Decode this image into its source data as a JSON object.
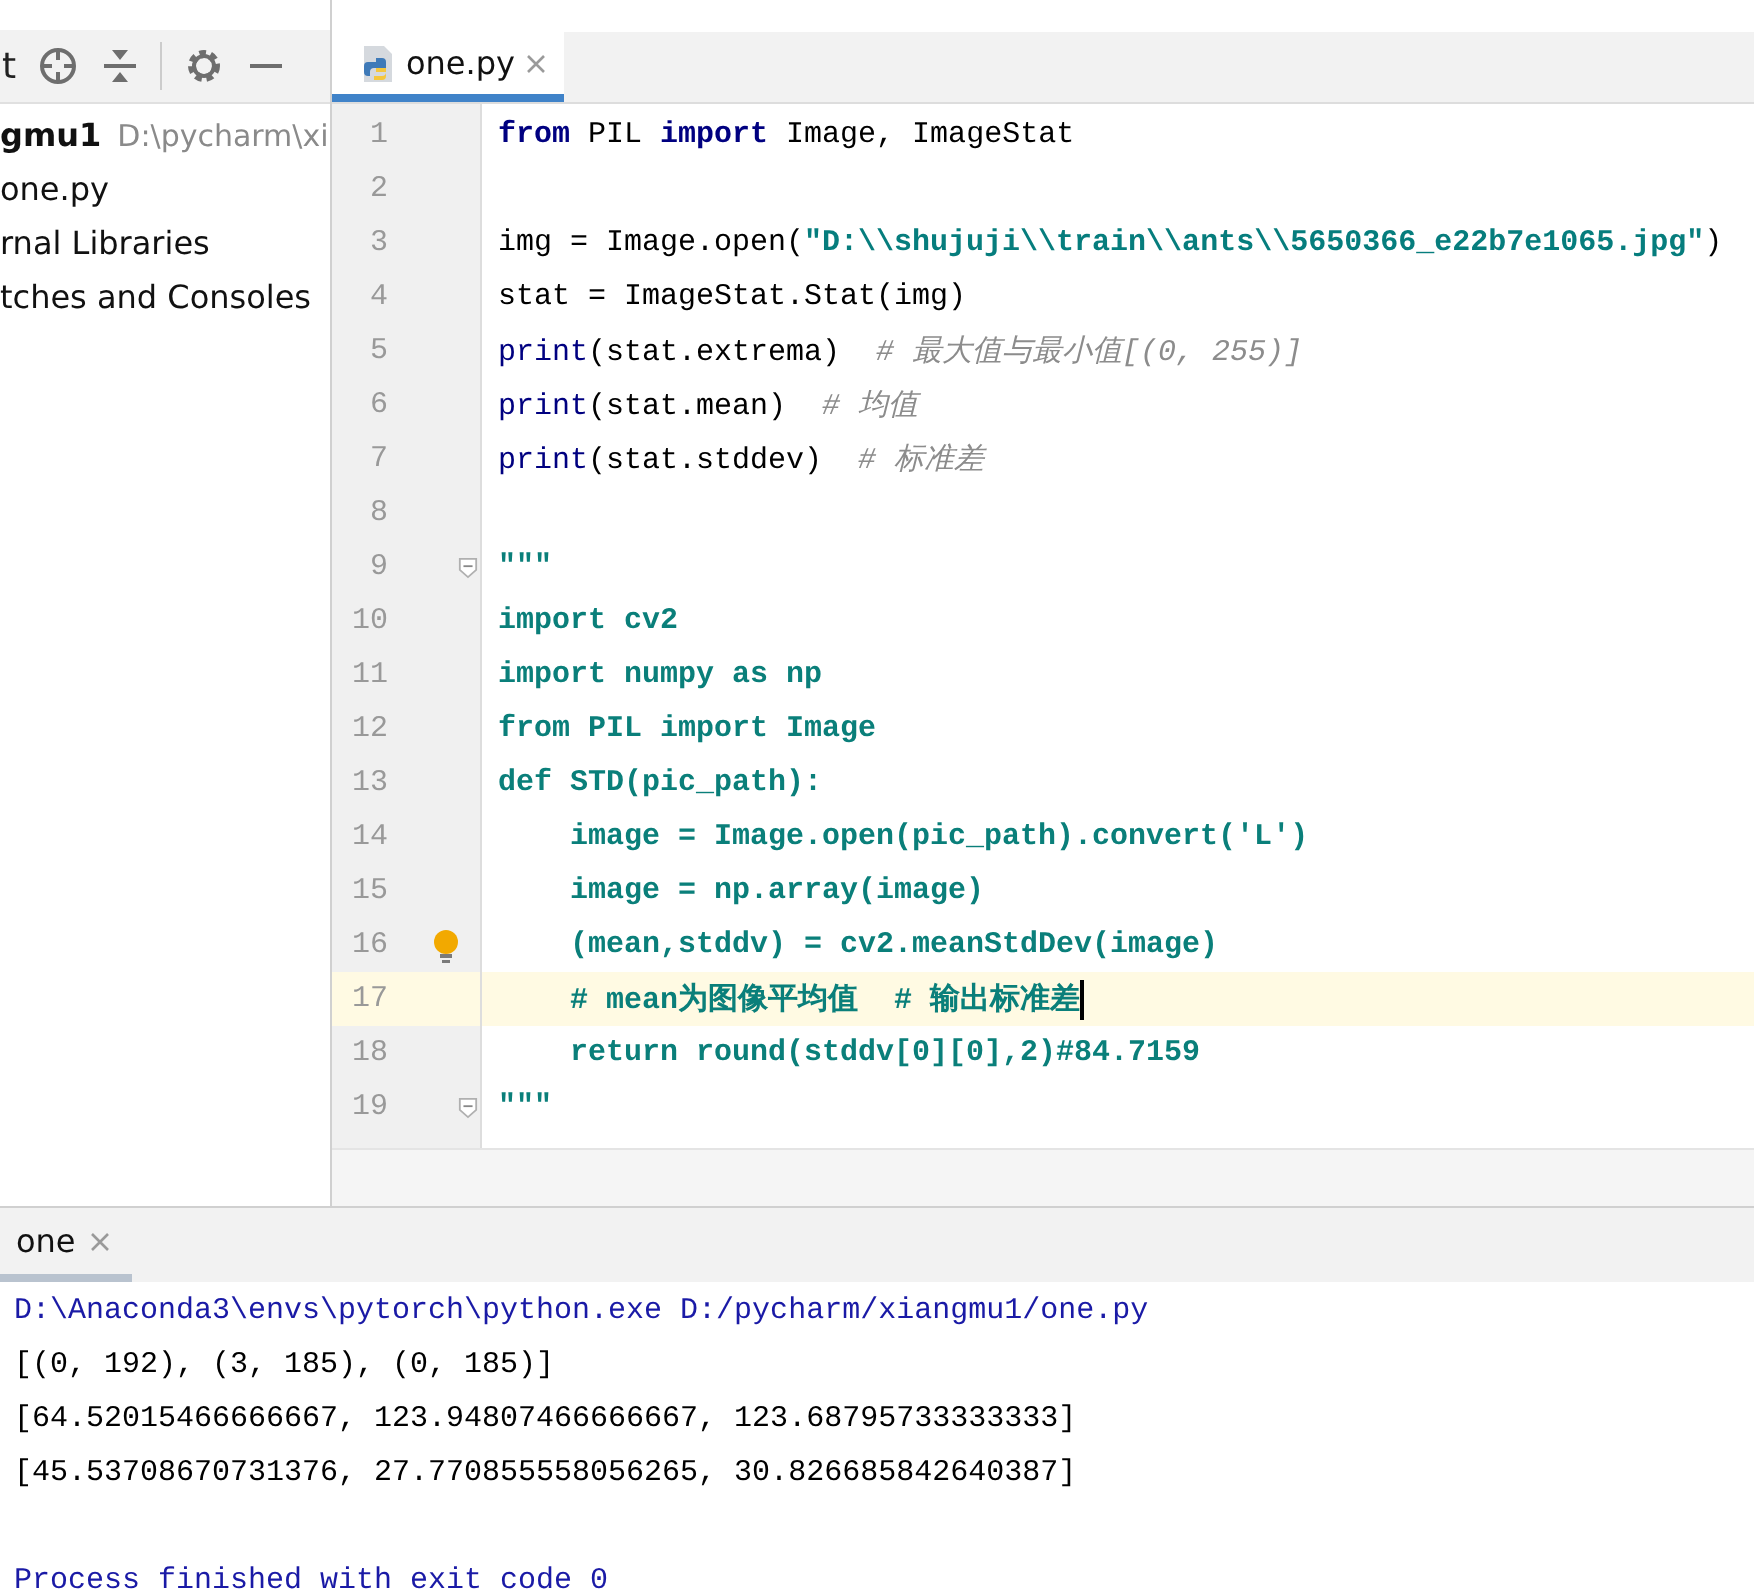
{
  "project_panel": {
    "toolbar_label": "t",
    "tree": [
      {
        "label": "gmu1",
        "path": "D:\\pycharm\\xi",
        "kind": "project"
      },
      {
        "label": "one.py",
        "kind": "file"
      },
      {
        "label": "rnal Libraries",
        "kind": "folder"
      },
      {
        "label": "tches and Consoles",
        "kind": "folder"
      }
    ]
  },
  "editor": {
    "tabs": [
      {
        "label": "one.py",
        "selected": true
      }
    ],
    "lines": [
      {
        "number": "1",
        "segments": [
          {
            "kind": "keyword",
            "text": "from"
          },
          {
            "kind": "plain",
            "text": " PIL "
          },
          {
            "kind": "keyword",
            "text": "import"
          },
          {
            "kind": "plain",
            "text": " Image, ImageStat"
          }
        ]
      },
      {
        "number": "2"
      },
      {
        "number": "3",
        "segments": [
          {
            "kind": "plain",
            "text": "img = Image.open("
          },
          {
            "kind": "string",
            "text": "\"D:\\\\shujuji\\\\train\\\\ants\\\\5650366_e22b7e1065.jpg\""
          },
          {
            "kind": "plain",
            "text": ")"
          }
        ]
      },
      {
        "number": "4",
        "segments": [
          {
            "kind": "plain",
            "text": "stat = ImageStat.Stat(img)"
          }
        ]
      },
      {
        "number": "5",
        "segments": [
          {
            "kind": "builtin",
            "text": "print"
          },
          {
            "kind": "plain",
            "text": "(stat.extrema)  "
          },
          {
            "kind": "comment",
            "text": "# 最大值与最小值[(0, 255)]"
          }
        ]
      },
      {
        "number": "6",
        "segments": [
          {
            "kind": "builtin",
            "text": "print"
          },
          {
            "kind": "plain",
            "text": "(stat.mean)  "
          },
          {
            "kind": "comment",
            "text": "# 均值"
          }
        ]
      },
      {
        "number": "7",
        "segments": [
          {
            "kind": "builtin",
            "text": "print"
          },
          {
            "kind": "plain",
            "text": "(stat.stddev)  "
          },
          {
            "kind": "comment",
            "text": "# 标准差"
          }
        ]
      },
      {
        "number": "8"
      },
      {
        "number": "9",
        "segments": [
          {
            "kind": "docstring",
            "text": "\"\"\""
          }
        ],
        "fold": true
      },
      {
        "number": "10",
        "segments": [
          {
            "kind": "docstring",
            "text": "import cv2"
          }
        ]
      },
      {
        "number": "11",
        "segments": [
          {
            "kind": "docstring",
            "text": "import numpy as np"
          }
        ]
      },
      {
        "number": "12",
        "segments": [
          {
            "kind": "docstring",
            "text": "from PIL import Image"
          }
        ]
      },
      {
        "number": "13",
        "segments": [
          {
            "kind": "docstring",
            "text": "def STD(pic_path):"
          }
        ]
      },
      {
        "number": "14",
        "segments": [
          {
            "kind": "docstring",
            "text": "    image = Image.open(pic_path).convert('L')"
          }
        ]
      },
      {
        "number": "15",
        "segments": [
          {
            "kind": "docstring",
            "text": "    image = np.array(image)"
          }
        ]
      },
      {
        "number": "16",
        "segments": [
          {
            "kind": "docstring",
            "text": "    (mean,stddv) = cv2.meanStdDev(image)"
          }
        ],
        "hint": true
      },
      {
        "number": "17",
        "segments": [
          {
            "kind": "docstring",
            "text": "    # mean为图像平均值  # 输出标准差"
          }
        ],
        "current": true
      },
      {
        "number": "18",
        "segments": [
          {
            "kind": "docstring",
            "text": "    return round(stddv[0][0],2)#84.7159"
          }
        ]
      },
      {
        "number": "19",
        "segments": [
          {
            "kind": "docstring",
            "text": "\"\"\""
          }
        ],
        "fold": true
      }
    ]
  },
  "run_panel": {
    "tabs": [
      {
        "label": "one",
        "selected": true
      }
    ],
    "output": [
      {
        "kind": "command",
        "text": "D:\\Anaconda3\\envs\\pytorch\\python.exe D:/pycharm/xiangmu1/one.py"
      },
      {
        "kind": "stdout",
        "text": "[(0, 192), (3, 185), (0, 185)]"
      },
      {
        "kind": "stdout",
        "text": "[64.52015466666667, 123.94807466666667, 123.68795733333333]"
      },
      {
        "kind": "stdout",
        "text": "[45.53708670731376, 27.770855558056265, 30.826685842640387]"
      },
      {
        "kind": "blank"
      },
      {
        "kind": "command",
        "text": "Process finished with exit code 0"
      }
    ]
  }
}
